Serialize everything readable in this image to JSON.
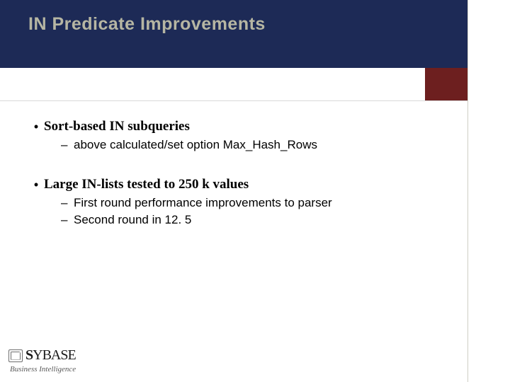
{
  "slide": {
    "title": "IN Predicate Improvements"
  },
  "bullets": [
    {
      "text": "Sort-based IN subqueries",
      "sub": [
        "above calculated/set option Max_Hash_Rows"
      ]
    },
    {
      "text": "Large IN-lists tested to 250 k values",
      "sub": [
        "First round performance improvements to parser",
        "Second round in 12. 5"
      ]
    }
  ],
  "footer": {
    "brand_prefix": "S",
    "brand_rest": "YBASE",
    "tagline": "Business Intelligence"
  }
}
